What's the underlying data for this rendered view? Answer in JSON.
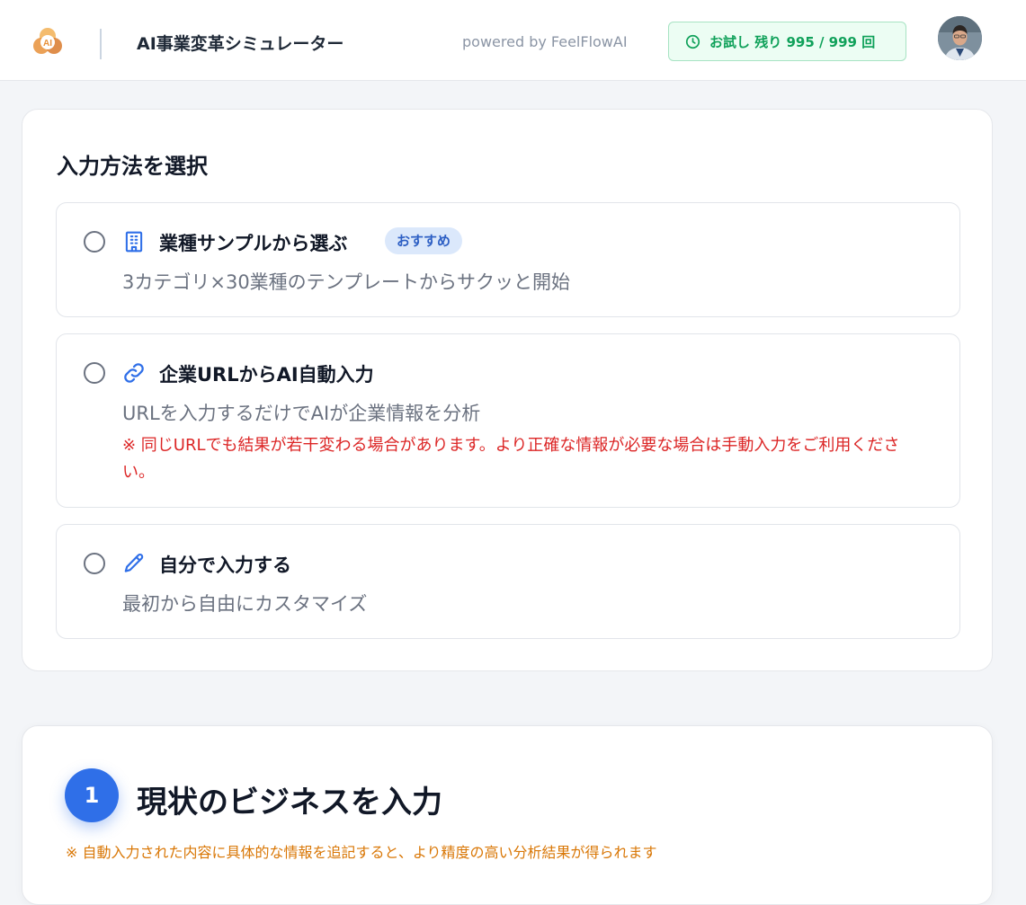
{
  "header": {
    "logo_text": "AI",
    "app_title": "AI事業変革シミュレーター",
    "powered_by": "powered by FeelFlowAI",
    "trial_badge": "お試し 残り 995 / 999 回",
    "trial_icon": "clock-icon",
    "avatar_icon": "user-avatar"
  },
  "input_method": {
    "title": "入力方法を選択",
    "options": [
      {
        "icon": "building-icon",
        "label": "業種サンプルから選ぶ",
        "badge": "おすすめ",
        "description": "3カテゴリ×30業種のテンプレートからサクッと開始",
        "selected": false
      },
      {
        "icon": "link-icon",
        "label": "企業URLからAI自動入力",
        "description": "URLを入力するだけでAIが企業情報を分析",
        "warning": "※ 同じURLでも結果が若干変わる場合があります。より正確な情報が必要な場合は手動入力をご利用ください。",
        "selected": false
      },
      {
        "icon": "pencil-icon",
        "label": "自分で入力する",
        "description": "最初から自由にカスタマイズ",
        "selected": false
      }
    ]
  },
  "step1": {
    "number": "1",
    "title": "現状のビジネスを入力",
    "note": "※ 自動入力された内容に具体的な情報を追記すると、より精度の高い分析結果が得られます"
  },
  "colors": {
    "accent": "#2f6fe8",
    "trial_green": "#10a15a",
    "warning_red": "#dc2626",
    "note_orange": "#d97706",
    "logo_orange": "#e8913a"
  }
}
